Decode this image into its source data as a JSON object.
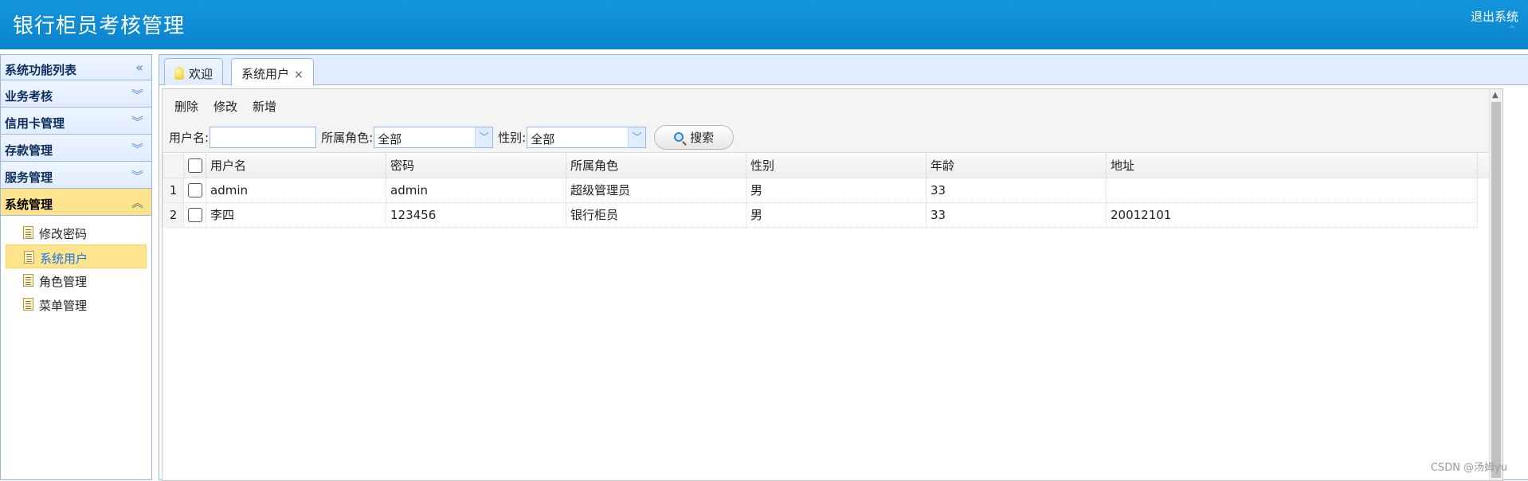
{
  "header": {
    "title": "银行柜员考核管理",
    "logout": "退出系统"
  },
  "sidebar": {
    "heading": "系统功能列表",
    "groups": [
      {
        "label": "业务考核"
      },
      {
        "label": "信用卡管理"
      },
      {
        "label": "存款管理"
      },
      {
        "label": "服务管理"
      },
      {
        "label": "系统管理"
      }
    ],
    "items": [
      {
        "label": "修改密码"
      },
      {
        "label": "系统用户"
      },
      {
        "label": "角色管理"
      },
      {
        "label": "菜单管理"
      }
    ]
  },
  "tabs": [
    {
      "label": "欢迎"
    },
    {
      "label": "系统用户",
      "close": "×"
    }
  ],
  "toolbar": {
    "delete": "删除",
    "edit": "修改",
    "add": "新增"
  },
  "search": {
    "username_label": "用户名:",
    "username_value": "",
    "role_label": "所属角色:",
    "role_value": "全部",
    "gender_label": "性别:",
    "gender_value": "全部",
    "search_button": "搜索"
  },
  "table": {
    "columns": [
      "用户名",
      "密码",
      "所属角色",
      "性别",
      "年龄",
      "地址"
    ],
    "rows": [
      {
        "no": "1",
        "cells": [
          "admin",
          "admin",
          "超级管理员",
          "男",
          "33",
          ""
        ]
      },
      {
        "no": "2",
        "cells": [
          "李四",
          "123456",
          "银行柜员",
          "男",
          "33",
          "20012101"
        ]
      }
    ]
  },
  "watermark": "CSDN @汤姆yu",
  "colors": {
    "header": "#0a83cc",
    "active_group": "#ffe48d",
    "border": "#95b8e7"
  }
}
